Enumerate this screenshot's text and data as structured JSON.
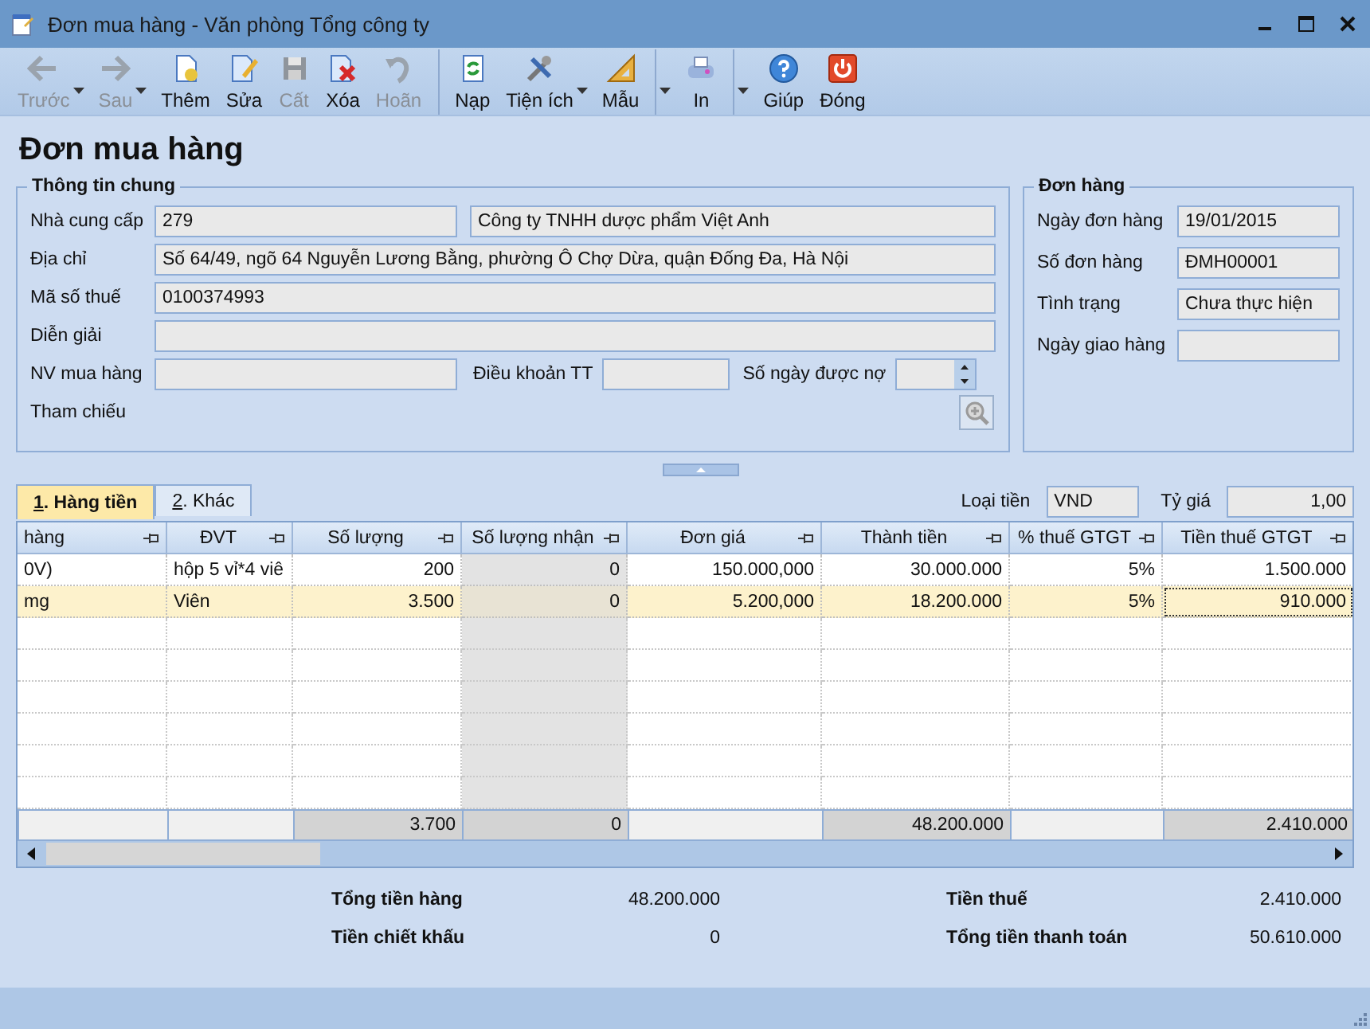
{
  "window": {
    "title": "Đơn mua hàng - Văn phòng Tổng công ty"
  },
  "toolbar": [
    {
      "kind": "back",
      "label": "Trước",
      "disabled": true,
      "dropdown": true,
      "separator_after": false
    },
    {
      "kind": "forward",
      "label": "Sau",
      "disabled": true,
      "dropdown": true,
      "separator_after": false
    },
    {
      "kind": "add",
      "label": "Thêm",
      "disabled": false,
      "dropdown": false,
      "separator_after": false
    },
    {
      "kind": "edit",
      "label": "Sửa",
      "disabled": false,
      "dropdown": false,
      "separator_after": false
    },
    {
      "kind": "save",
      "label": "Cất",
      "disabled": true,
      "dropdown": false,
      "separator_after": false
    },
    {
      "kind": "delete",
      "label": "Xóa",
      "disabled": false,
      "dropdown": false,
      "separator_after": false
    },
    {
      "kind": "undo",
      "label": "Hoãn",
      "disabled": true,
      "dropdown": false,
      "separator_after": true
    },
    {
      "kind": "refresh",
      "label": "Nạp",
      "disabled": false,
      "dropdown": false,
      "separator_after": false
    },
    {
      "kind": "tools",
      "label": "Tiện ích",
      "disabled": false,
      "dropdown": true,
      "separator_after": false
    },
    {
      "kind": "ruler",
      "label": "Mẫu",
      "disabled": false,
      "dropdown": true,
      "separator_after": true
    },
    {
      "kind": "print",
      "label": "In",
      "disabled": false,
      "dropdown": true,
      "separator_after": true
    },
    {
      "kind": "help",
      "label": "Giúp",
      "disabled": false,
      "dropdown": false,
      "separator_after": false
    },
    {
      "kind": "power",
      "label": "Đóng",
      "disabled": false,
      "dropdown": false,
      "separator_after": false
    }
  ],
  "heading": "Đơn mua hàng",
  "general": {
    "title": "Thông tin chung",
    "supplier": {
      "label": "Nhà cung cấp",
      "code": "279",
      "name": "Công ty TNHH dược phẩm Việt Anh"
    },
    "address": {
      "label": "Địa chỉ",
      "value": "Số 64/49, ngõ 64 Nguyễn Lương Bằng, phường Ô Chợ Dừa, quận Đống Đa, Hà Nội"
    },
    "tax_code": {
      "label": "Mã số thuế",
      "value": "0100374993"
    },
    "description": {
      "label": "Diễn giải"
    },
    "buyer": {
      "label": "NV mua hàng"
    },
    "payment_terms": {
      "label": "Điều khoản TT"
    },
    "credit_days": {
      "label": "Số ngày được nợ"
    },
    "reference": {
      "label": "Tham chiếu"
    }
  },
  "order": {
    "title": "Đơn hàng",
    "fields": [
      {
        "label": "Ngày đơn hàng",
        "value": "19/01/2015"
      },
      {
        "label": "Số đơn hàng",
        "value": "ĐMH00001"
      },
      {
        "label": "Tình trạng",
        "value": "Chưa thực hiện"
      },
      {
        "label": "Ngày giao hàng"
      }
    ]
  },
  "tabs": [
    {
      "label": "1. Hàng tiền",
      "selected": true
    },
    {
      "label": "2. Khác",
      "selected": false
    }
  ],
  "currency": {
    "label": "Loại tiền",
    "value": "VND"
  },
  "rate": {
    "label": "Tỷ giá",
    "value": "1,00"
  },
  "grid": {
    "columns": [
      {
        "label": "hàng",
        "kind": "text",
        "readonly": false
      },
      {
        "label": "ĐVT",
        "kind": "text",
        "readonly": false
      },
      {
        "label": "Số lượng",
        "kind": "number",
        "readonly": false
      },
      {
        "label": "Số lượng nhận",
        "kind": "number",
        "readonly": true
      },
      {
        "label": "Đơn giá",
        "kind": "number",
        "readonly": false
      },
      {
        "label": "Thành tiền",
        "kind": "number",
        "readonly": false
      },
      {
        "label": "% thuế GTGT",
        "kind": "number",
        "readonly": false
      },
      {
        "label": "Tiền thuế GTGT",
        "kind": "number",
        "readonly": false
      }
    ],
    "rows": [
      {
        "selected": false,
        "cells": [
          "0V)",
          "hộp 5 vỉ*4 viê",
          "200",
          "0",
          "150.000,000",
          "30.000.000",
          "5%",
          "1.500.000"
        ]
      },
      {
        "selected": true,
        "cells": [
          "mg",
          "Viên",
          "3.500",
          "0",
          "5.200,000",
          "18.200.000",
          "5%",
          "910.000"
        ]
      }
    ],
    "footer": [
      {
        "kind": "blank"
      },
      {
        "kind": "blank"
      },
      {
        "kind": "sum",
        "value": "3.700"
      },
      {
        "kind": "sum",
        "value": "0"
      },
      {
        "kind": "blank"
      },
      {
        "kind": "sum",
        "value": "48.200.000"
      },
      {
        "kind": "blank"
      },
      {
        "kind": "sum",
        "value": "2.410.000"
      }
    ]
  },
  "totals": [
    {
      "label": "Tổng tiền hàng",
      "value": "48.200.000"
    },
    {
      "label": "Tiền chiết khấu",
      "value": "0"
    },
    {
      "label": "Tiền thuế",
      "value": "2.410.000"
    },
    {
      "label": "Tổng tiền thanh toán",
      "value": "50.610.000"
    }
  ]
}
